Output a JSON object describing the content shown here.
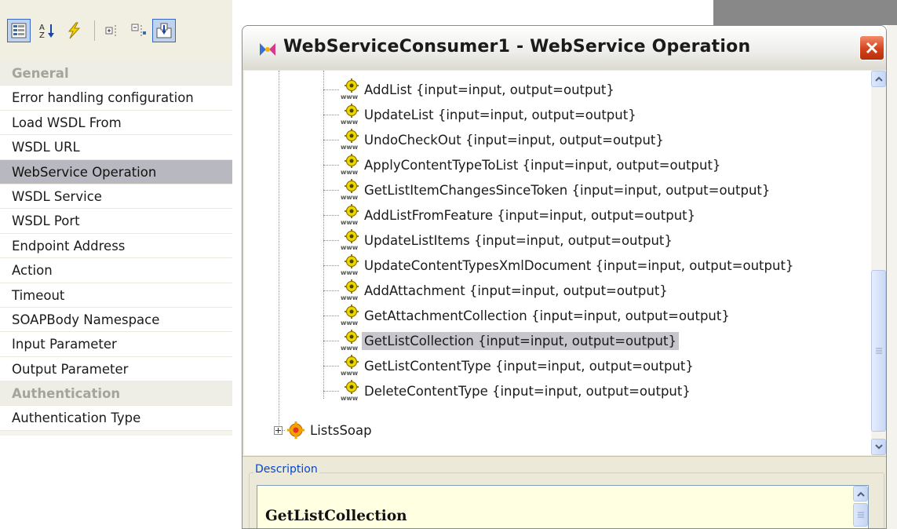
{
  "property_panel": {
    "toolbar": {
      "buttons": [
        {
          "name": "categorized-icon"
        },
        {
          "name": "sort-alphabetical-icon"
        },
        {
          "name": "events-lightning-icon"
        },
        {
          "name": "expand-all-icon"
        },
        {
          "name": "collapse-all-icon"
        },
        {
          "name": "property-pages-icon"
        }
      ]
    },
    "rows": [
      {
        "label": "General",
        "type": "category"
      },
      {
        "label": "Error handling configuration",
        "type": "item"
      },
      {
        "label": "Load WSDL From",
        "type": "item"
      },
      {
        "label": "WSDL URL",
        "type": "item"
      },
      {
        "label": "WebService Operation",
        "type": "item",
        "selected": true
      },
      {
        "label": "WSDL Service",
        "type": "item"
      },
      {
        "label": "WSDL Port",
        "type": "item"
      },
      {
        "label": "Endpoint Address",
        "type": "item"
      },
      {
        "label": "Action",
        "type": "item"
      },
      {
        "label": "Timeout",
        "type": "item"
      },
      {
        "label": "SOAPBody Namespace",
        "type": "item"
      },
      {
        "label": "Input Parameter",
        "type": "item"
      },
      {
        "label": "Output Parameter",
        "type": "item"
      },
      {
        "label": "Authentication",
        "type": "category"
      },
      {
        "label": "Authentication Type",
        "type": "item"
      }
    ]
  },
  "dialog": {
    "title": "WebServiceConsumer1 - WebService Operation",
    "operations": [
      {
        "label": "AddList {input=input, output=output}"
      },
      {
        "label": "UpdateList {input=input, output=output}"
      },
      {
        "label": "UndoCheckOut {input=input, output=output}"
      },
      {
        "label": "ApplyContentTypeToList {input=input, output=output}"
      },
      {
        "label": "GetListItemChangesSinceToken {input=input, output=output}"
      },
      {
        "label": "AddListFromFeature {input=input, output=output}"
      },
      {
        "label": "UpdateListItems {input=input, output=output}"
      },
      {
        "label": "UpdateContentTypesXmlDocument {input=input, output=output}"
      },
      {
        "label": "AddAttachment {input=input, output=output}"
      },
      {
        "label": "GetAttachmentCollection {input=input, output=output}"
      },
      {
        "label": "GetListCollection {input=input, output=output}",
        "selected": true
      },
      {
        "label": "GetListContentType {input=input, output=output}"
      },
      {
        "label": "DeleteContentType {input=input, output=output}"
      }
    ],
    "port_node": {
      "label": "ListsSoap"
    },
    "description": {
      "legend": "Description",
      "text": "GetListCollection"
    }
  },
  "colors": {
    "selection": "#c6c6cc",
    "close_button": "#d2431c",
    "description_background": "#ffffe1",
    "legend_text": "#0046d5"
  }
}
